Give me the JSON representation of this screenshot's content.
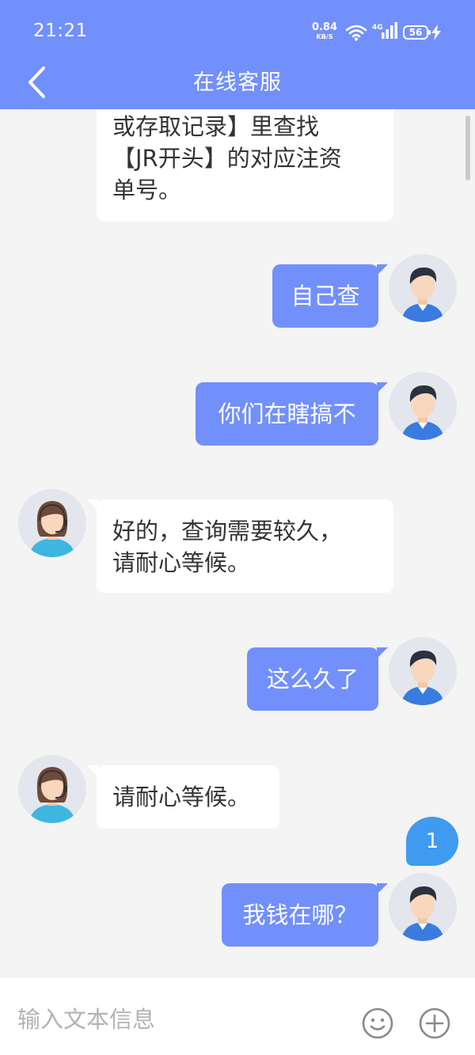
{
  "status_bar": {
    "time": "21:21",
    "net_speed_value": "0.84",
    "net_speed_unit": "KB/S",
    "network_type": "4G",
    "battery": "56"
  },
  "nav": {
    "title": "在线客服",
    "back_icon": "chevron-left-icon"
  },
  "messages": [
    {
      "sender": "agent",
      "text": "或存取记录】里查找\n【JR开头】的对应注资\n单号。"
    },
    {
      "sender": "user",
      "text": "自己查"
    },
    {
      "sender": "user",
      "text": "你们在瞎搞不"
    },
    {
      "sender": "agent",
      "text": "好的，查询需要较久，\n请耐心等候。"
    },
    {
      "sender": "user",
      "text": "这么久了"
    },
    {
      "sender": "agent",
      "text": "请耐心等候。"
    },
    {
      "sender": "user",
      "text": "我钱在哪？"
    }
  ],
  "unread_count": "1",
  "input": {
    "placeholder": "输入文本信息",
    "value": "",
    "emoji_icon": "smiley-icon",
    "plus_icon": "plus-circle-icon"
  },
  "colors": {
    "header": "#7290fb",
    "user_bubble": "#7290fb",
    "agent_bubble": "#ffffff",
    "background": "#f4f4f5",
    "badge": "#3f9bf0"
  }
}
